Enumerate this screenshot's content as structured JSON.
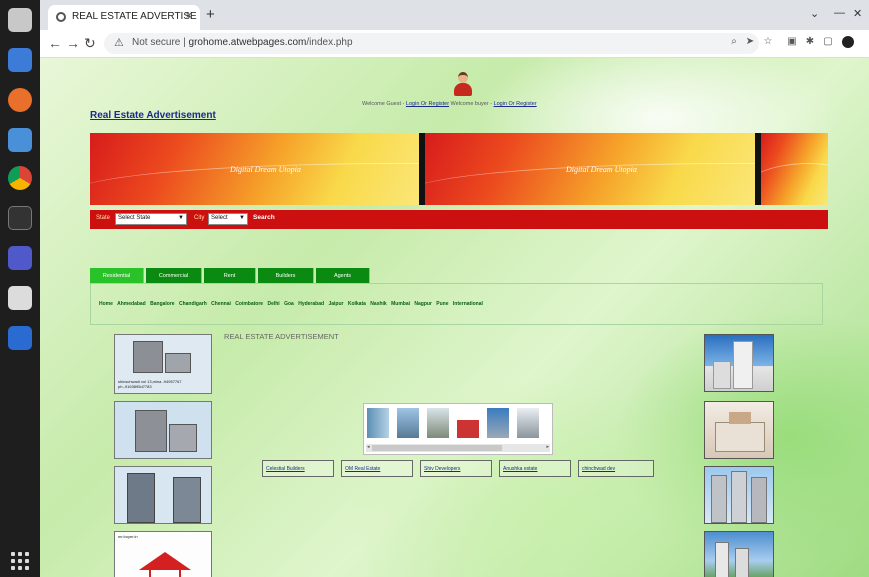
{
  "browser": {
    "tab_title": "REAL ESTATE ADVERTISE",
    "tab_close": "×",
    "new_tab": "+",
    "url_security": "Not secure",
    "url_separator": "|",
    "url_host": "grohome.atwebpages.com",
    "url_path": "/index.php",
    "win_min": "⌄",
    "win_max": "—",
    "win_close": "✕"
  },
  "page": {
    "site_title": "Real Estate Advertisement",
    "welcome": {
      "guest_text": "Welcome Guest - ",
      "guest_link": "Login Or Register",
      "buyer_text": " Welcome buyer - ",
      "buyer_link": "Login Or Register"
    },
    "banner_text": "Digital Dream Utopia",
    "search": {
      "state_label": "State",
      "state_value": "Select State",
      "city_label": "City",
      "city_value": "Select",
      "button": "Search"
    },
    "category_tabs": [
      "Residential",
      "Commercial",
      "Rent",
      "Builders",
      "Agents"
    ],
    "cities": [
      "Home",
      "Ahmedabad",
      "Bangalore",
      "Chandigarh",
      "Chennai",
      "Coimbatore",
      "Delhi",
      "Goa",
      "Hyderabad",
      "Jaipur",
      "Kolkata",
      "Nashik",
      "Mumbai",
      "Nagpur",
      "Pune",
      "International"
    ],
    "content_heading": "REAL ESTATE ADVERTISEMENT",
    "thumb_caption_1": "shinschwadi vol 13,mina -94957767",
    "thumb_caption_2": "ph.-9163895d7783",
    "thumb_caption_3": "mr.buyer.in",
    "builders": [
      "Celestial Builders",
      "OM Real Estate",
      "Shiv Developers",
      "Anushka estate",
      "chinchwad dev"
    ]
  },
  "colors": {
    "accent_red": "#cc1010",
    "tab_green": "#0a8a10",
    "tab_active": "#29c229",
    "link_blue": "#1a2a8a"
  }
}
